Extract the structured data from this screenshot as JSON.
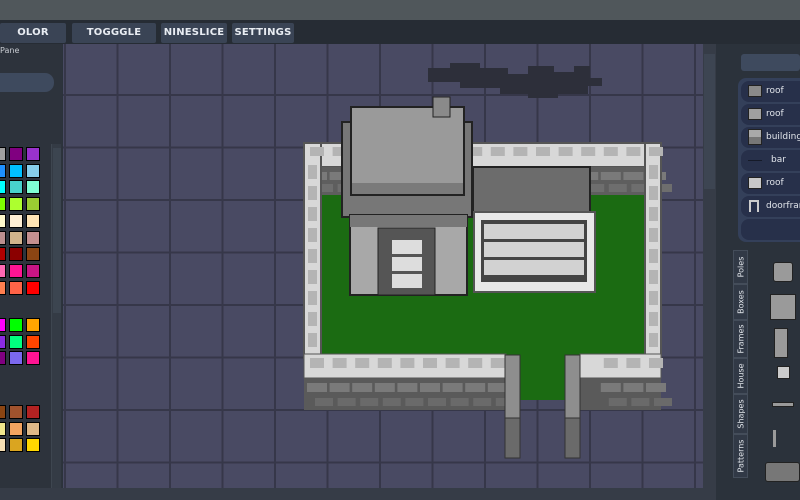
{
  "toolbar": {
    "buttons": [
      "OLOR PANEL",
      "TOGGGLE GRID",
      "NINESLICE",
      "SETTINGS"
    ]
  },
  "left_panel": {
    "label": "Pane",
    "palette_groups": [
      [
        [
          "#a0a0a0",
          "#800080",
          "#9932cc"
        ],
        [
          "#1e90ff",
          "#00bfff",
          "#87ceeb"
        ],
        [
          "#00ffff",
          "#48d1cc",
          "#7fffd4"
        ],
        [
          "#7fff00",
          "#adff2f",
          "#9acd32"
        ],
        [
          "#fffacd",
          "#ffefd5",
          "#ffe4b5"
        ],
        [
          "#bc8f8f",
          "#d2b48c",
          "#c49090"
        ],
        [
          "#b00000",
          "#8b0000",
          "#8b4513"
        ],
        [
          "#ff69b4",
          "#ff1493",
          "#c71585"
        ],
        [
          "#ff7f50",
          "#ff6347",
          "#ff0000"
        ]
      ],
      [
        [
          "#ff00ff",
          "#00ff00",
          "#ffa500"
        ],
        [
          "#8a2be2",
          "#00ff7f",
          "#ff4500"
        ],
        [
          "#800080",
          "#7b68ee",
          "#ff1493"
        ]
      ],
      [
        [
          "#8b4513",
          "#a0522d",
          "#b22222"
        ],
        [
          "#f0e68c",
          "#f4a460",
          "#deb887"
        ],
        [
          "#f5deb3",
          "#daa520",
          "#ffd700"
        ]
      ]
    ]
  },
  "right_panel": {
    "layers": [
      {
        "label": "roof",
        "icon": "roof-swatch-icon",
        "color": "#8a8a8a"
      },
      {
        "label": "roof",
        "icon": "roof-swatch-icon",
        "color": "#a0a0a0"
      },
      {
        "label": "building",
        "icon": "building-swatch-icon",
        "color": "#9a9a9a"
      },
      {
        "label": "bar",
        "icon": "bar-line-icon",
        "color": "#1a2030"
      },
      {
        "label": "roof",
        "icon": "roof-swatch-icon",
        "color": "#c8c8c8"
      },
      {
        "label": "doorframe",
        "icon": "doorframe-icon",
        "color": "#cccccc"
      }
    ],
    "tabs": [
      "Poles",
      "Boxes",
      "Frames",
      "House",
      "Shapes",
      "Patterns"
    ]
  },
  "colors": {
    "canvas": "#494a63",
    "grid": "#363749",
    "grass": "#1b6b12",
    "smoke": "#2d2f3a"
  }
}
